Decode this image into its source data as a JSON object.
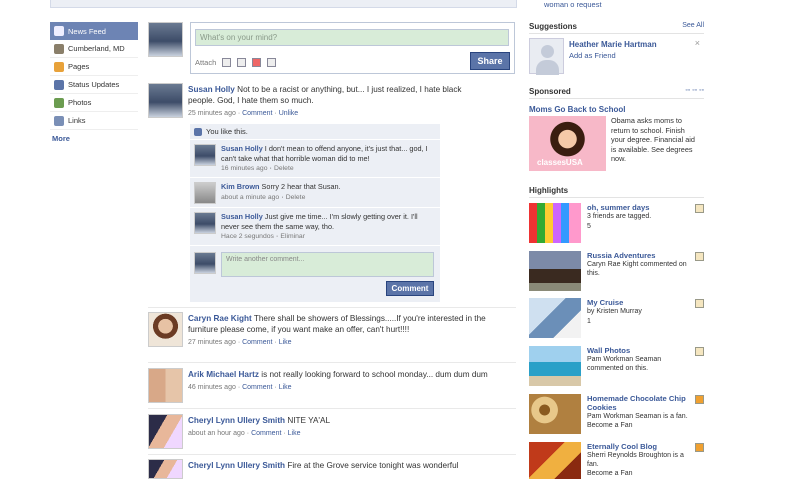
{
  "top_right_snippet": "woman o request",
  "nav": [
    {
      "label": "News Feed",
      "color": "#f2f2f2"
    },
    {
      "label": "Cumberland, MD",
      "color": "#8a7f6a"
    },
    {
      "label": "Pages",
      "color": "#e8a23a"
    },
    {
      "label": "Status Updates",
      "color": "#5b74a8"
    },
    {
      "label": "Photos",
      "color": "#6b9c50"
    },
    {
      "label": "Links",
      "color": "#7a8fb6"
    }
  ],
  "nav_more": "More",
  "composer": {
    "placeholder": "What's on your mind?",
    "attach": "Attach",
    "share": "Share"
  },
  "stories": [
    {
      "name": "Susan Holly",
      "text": "Not to be a racist or anything, but... I just realized, I hate black people. God, I hate them so much.",
      "time": "25 minutes ago",
      "comment": "Comment",
      "action": "Unlike"
    },
    {
      "name": "Caryn Rae Kight",
      "text": "There shall be showers of Blessings.....If you're interested in the furniture please come, if you want make an offer, can't hurt!!!!",
      "time": "27 minutes ago",
      "comment": "Comment",
      "action": "Like"
    },
    {
      "name": "Arik Michael Hartz",
      "text": "is not really looking forward to school monday... dum dum dum",
      "time": "46 minutes ago",
      "comment": "Comment",
      "action": "Like"
    },
    {
      "name": "Cheryl Lynn Ullery Smith",
      "text": "NITE YA'AL",
      "time": "about an hour ago",
      "comment": "Comment",
      "action": "Like"
    },
    {
      "name": "Cheryl Lynn Ullery Smith",
      "text": "Fire at the Grove service tonight was wonderful",
      "time": "",
      "comment": "",
      "action": ""
    }
  ],
  "comments": {
    "you_like": "You like this.",
    "items": [
      {
        "name": "Susan Holly",
        "text": "I don't mean to offend anyone, it's just that... god, I can't take what that horrible woman did to me!",
        "time": "16 minutes ago",
        "action": "Delete"
      },
      {
        "name": "Kim Brown",
        "text": "Sorry 2 hear that Susan.",
        "time": "about a minute ago",
        "action": "Delete"
      },
      {
        "name": "Susan Holly",
        "text": "Just give me time... I'm slowly getting over it. I'll never see them the same way, tho.",
        "time": "Hace 2 segundos",
        "action": "Eliminar"
      }
    ],
    "write_placeholder": "Write another comment...",
    "button": "Comment"
  },
  "suggestions": {
    "title": "Suggestions",
    "see_all": "See All",
    "name": "Heather Marie Hartman",
    "add": "Add as Friend",
    "close": "×"
  },
  "sponsored": {
    "title": "Sponsored",
    "ad_title": "Moms Go Back to School",
    "ad_text": "Obama asks moms to return to school. Finish your degree. Financial aid is available. See degrees now.",
    "ad_logo": "classesUSA"
  },
  "highlights": {
    "title": "Highlights",
    "items": [
      {
        "title": "oh, summer days",
        "sub": "3 friends are tagged.",
        "extra": "5"
      },
      {
        "title": "Russia Adventures",
        "sub": "Caryn Rae Kight commented on this.",
        "extra": ""
      },
      {
        "title": "My Cruise",
        "sub": "by Kristen Murray",
        "extra": "1"
      },
      {
        "title": "Wall Photos",
        "sub": "Pam Workman Seaman commented on this.",
        "extra": ""
      },
      {
        "title": "Homemade Chocolate Chip Cookies",
        "sub": "Pam Workman Seaman is a fan.",
        "extra": "Become a Fan"
      },
      {
        "title": "Eternally Cool Blog",
        "sub": "Sherri Reynolds Broughton is a fan.",
        "extra": "Become a Fan"
      }
    ]
  }
}
